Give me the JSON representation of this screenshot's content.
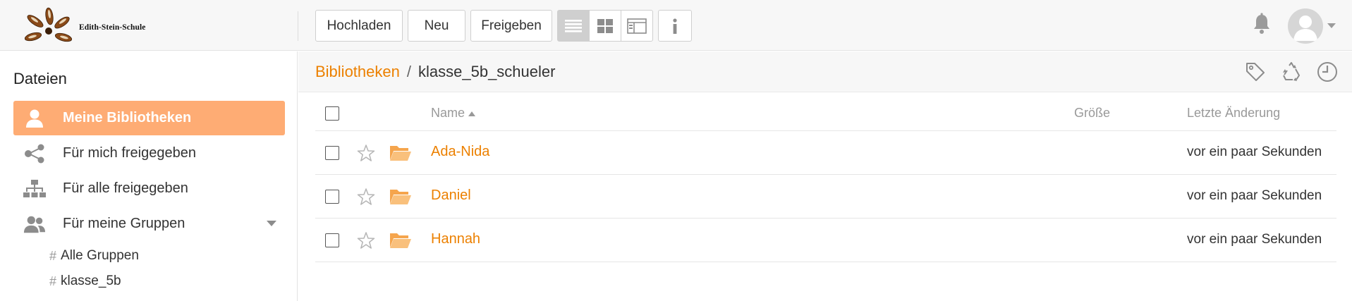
{
  "header": {
    "logo_text": "Edith-Stein-Schule",
    "toolbar": {
      "upload_label": "Hochladen",
      "new_label": "Neu",
      "share_label": "Freigeben"
    },
    "view_modes": [
      "list-view",
      "grid-view",
      "column-view"
    ],
    "active_view": "list-view",
    "info_icon": "info-icon",
    "notification_icon": "bell-icon",
    "avatar_icon": "user-avatar"
  },
  "sidebar": {
    "title": "Dateien",
    "items": [
      {
        "label": "Meine Bibliotheken",
        "icon": "user-icon",
        "active": true
      },
      {
        "label": "Für mich freigegeben",
        "icon": "share-icon",
        "active": false
      },
      {
        "label": "Für alle freigegeben",
        "icon": "org-chart-icon",
        "active": false
      },
      {
        "label": "Für meine Gruppen",
        "icon": "group-icon",
        "active": false,
        "expandable": true
      }
    ],
    "groups": [
      {
        "label": "Alle Gruppen"
      },
      {
        "label": "klasse_5b"
      }
    ]
  },
  "path": {
    "root_label": "Bibliotheken",
    "separator": "/",
    "current": "klasse_5b_schueler",
    "ops": [
      "tag-icon",
      "recycle-icon",
      "history-icon"
    ]
  },
  "table": {
    "columns": {
      "name": "Name",
      "size": "Größe",
      "modified": "Letzte Änderung"
    },
    "sort": {
      "column": "name",
      "direction": "asc"
    },
    "rows": [
      {
        "name": "Ada-Nida",
        "size": "",
        "modified": "vor ein paar Sekunden"
      },
      {
        "name": "Daniel",
        "size": "",
        "modified": "vor ein paar Sekunden"
      },
      {
        "name": "Hannah",
        "size": "",
        "modified": "vor ein paar Sekunden"
      }
    ]
  },
  "colors": {
    "accent": "#ec8000",
    "active_nav_bg": "#feac74",
    "folder": "#f7b468"
  }
}
